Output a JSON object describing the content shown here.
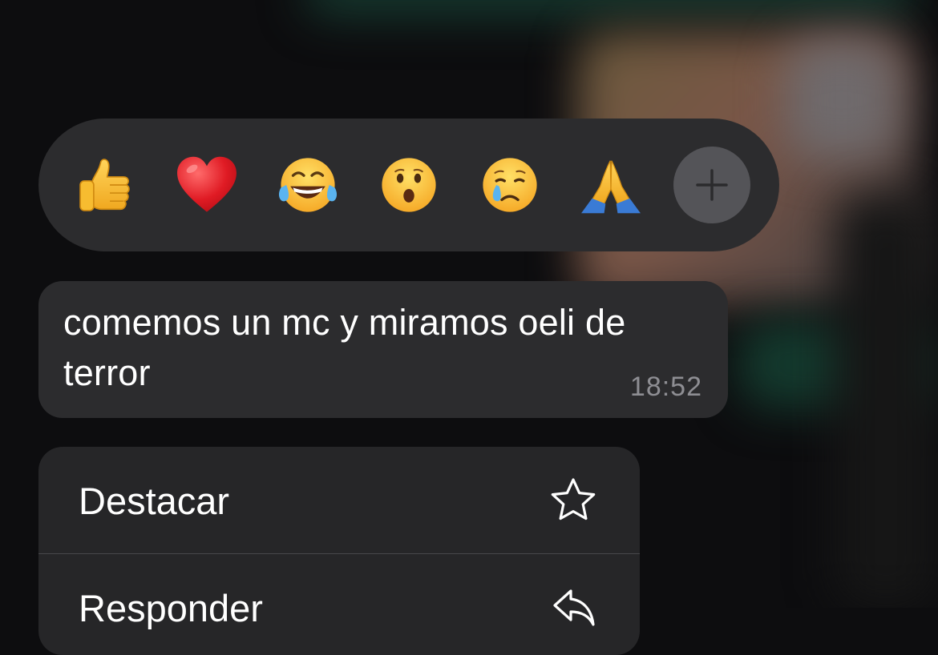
{
  "reactions": {
    "emojis": [
      {
        "glyph": "👍",
        "icon": "thumbs-up-icon"
      },
      {
        "glyph": "❤️",
        "icon": "red-heart-icon"
      },
      {
        "glyph": "😂",
        "icon": "tears-of-joy-icon"
      },
      {
        "glyph": "😮",
        "icon": "surprised-face-icon"
      },
      {
        "glyph": "😢",
        "icon": "crying-face-icon"
      },
      {
        "glyph": "🙏",
        "icon": "folded-hands-icon"
      }
    ],
    "more_icon": "plus-icon"
  },
  "message": {
    "text": "comemos un mc y miramos oeli de terror",
    "time": "18:52"
  },
  "context_menu": {
    "items": [
      {
        "label": "Destacar",
        "icon": "star-icon"
      },
      {
        "label": "Responder",
        "icon": "reply-arrow-icon"
      }
    ]
  },
  "colors": {
    "bubble": "#2c2c2e",
    "menu": "#262628",
    "plus_button": "#545458",
    "timestamp": "#8e8e93"
  }
}
